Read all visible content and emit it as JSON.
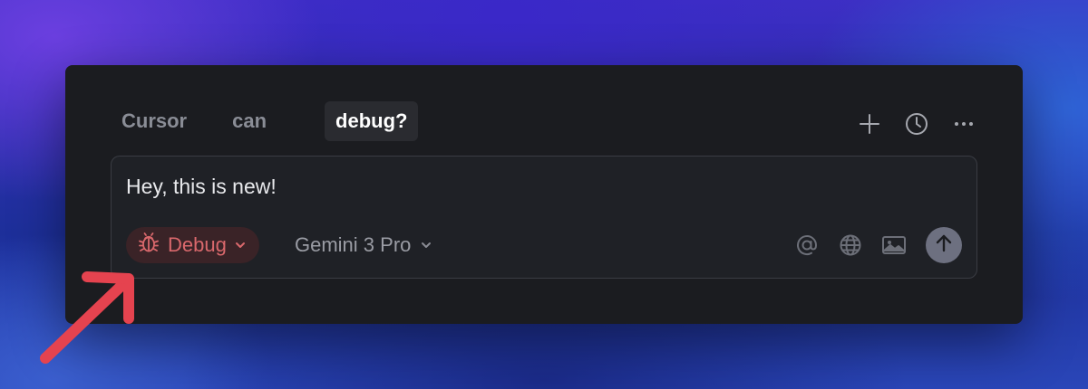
{
  "tabs": [
    {
      "label": "Cursor"
    },
    {
      "label": "can"
    },
    {
      "label": "debug?"
    }
  ],
  "toolbar": {
    "icons": [
      "plus-icon",
      "history-icon",
      "more-icon"
    ]
  },
  "composer": {
    "text": "Hey, this is new!",
    "mode": {
      "label": "Debug",
      "icon": "bug-icon",
      "color": "#d9686c"
    },
    "model": {
      "label": "Gemini 3 Pro"
    },
    "icons": [
      "at-mention-icon",
      "globe-icon",
      "image-icon",
      "send-arrow-icon"
    ]
  },
  "colors": {
    "window_bg": "#1b1c20",
    "composer_bg": "#1f2126",
    "mode_pill_bg": "#3a2327",
    "annotation_arrow": "#e5434f"
  }
}
